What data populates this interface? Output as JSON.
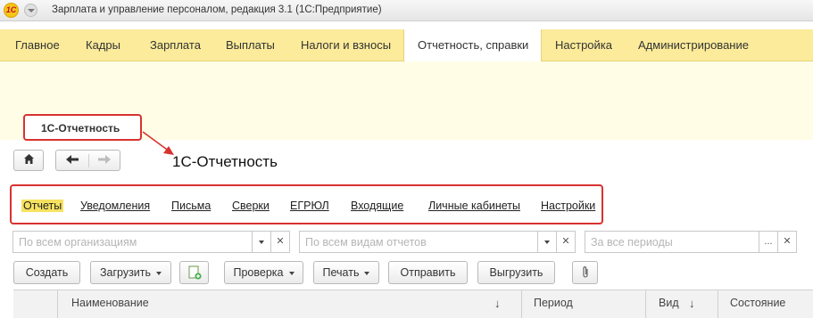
{
  "window": {
    "title": "Зарплата и управление персоналом, редакция 3.1  (1С:Предприятие)",
    "logo_text": "1С"
  },
  "sections": [
    {
      "label": "Главное"
    },
    {
      "label": "Кадры"
    },
    {
      "label": "Зарплата"
    },
    {
      "label": "Выплаты"
    },
    {
      "label": "Налоги и взносы"
    },
    {
      "label": "Отчетность, справки"
    },
    {
      "label": "Настройка"
    },
    {
      "label": "Администрирование"
    }
  ],
  "badge": {
    "label": "1С-Отчетность"
  },
  "page": {
    "title": "1С-Отчетность"
  },
  "tabs": [
    {
      "label": "Отчеты"
    },
    {
      "label": "Уведомления"
    },
    {
      "label": "Письма"
    },
    {
      "label": "Сверки"
    },
    {
      "label": "ЕГРЮЛ"
    },
    {
      "label": "Входящие"
    },
    {
      "label": "Личные кабинеты"
    },
    {
      "label": "Настройки"
    }
  ],
  "filters": {
    "organizations_placeholder": "По всем организациям",
    "report_types_placeholder": "По всем видам отчетов",
    "periods_placeholder": "За все периоды"
  },
  "toolbar": {
    "create": "Создать",
    "load": "Загрузить",
    "check": "Проверка",
    "print": "Печать",
    "send": "Отправить",
    "export": "Выгрузить"
  },
  "table": {
    "columns": [
      "Наименование",
      "Период",
      "Вид",
      "Состояние"
    ],
    "sort_indicator": "↓"
  },
  "colors": {
    "section_bar": "#fbeb9a",
    "highlight_red": "#d8322f",
    "active_tab": "#f6e25f"
  }
}
